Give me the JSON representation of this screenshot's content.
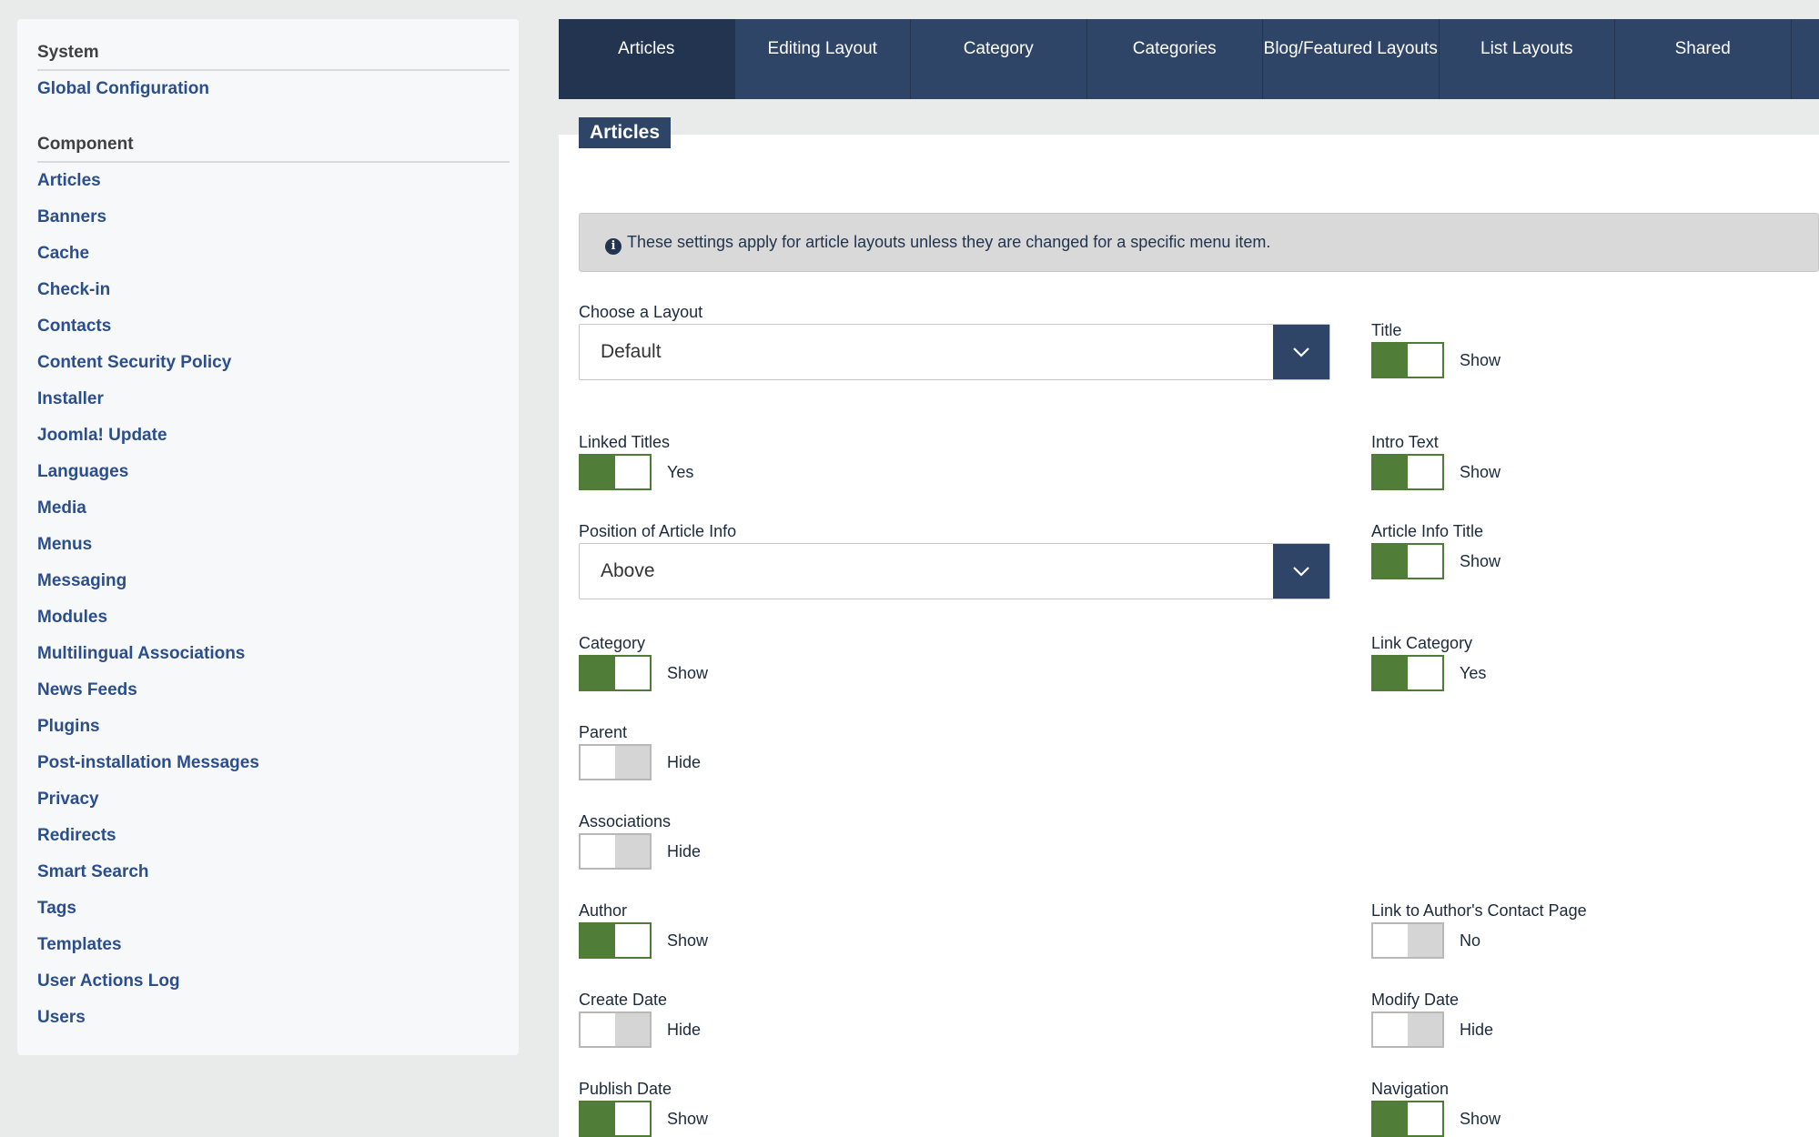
{
  "sidebar": {
    "system_heading": "System",
    "system_items": [
      {
        "label": "Global Configuration"
      }
    ],
    "component_heading": "Component",
    "component_items": [
      {
        "label": "Articles"
      },
      {
        "label": "Banners"
      },
      {
        "label": "Cache"
      },
      {
        "label": "Check-in"
      },
      {
        "label": "Contacts"
      },
      {
        "label": "Content Security Policy"
      },
      {
        "label": "Installer"
      },
      {
        "label": "Joomla! Update"
      },
      {
        "label": "Languages"
      },
      {
        "label": "Media"
      },
      {
        "label": "Menus"
      },
      {
        "label": "Messaging"
      },
      {
        "label": "Modules"
      },
      {
        "label": "Multilingual Associations"
      },
      {
        "label": "News Feeds"
      },
      {
        "label": "Plugins"
      },
      {
        "label": "Post-installation Messages"
      },
      {
        "label": "Privacy"
      },
      {
        "label": "Redirects"
      },
      {
        "label": "Smart Search"
      },
      {
        "label": "Tags"
      },
      {
        "label": "Templates"
      },
      {
        "label": "User Actions Log"
      },
      {
        "label": "Users"
      }
    ]
  },
  "tabs": [
    {
      "label": "Articles",
      "active": true
    },
    {
      "label": "Editing Layout"
    },
    {
      "label": "Category"
    },
    {
      "label": "Categories"
    },
    {
      "label": "Blog/Featured Layouts"
    },
    {
      "label": "List Layouts"
    },
    {
      "label": "Shared"
    }
  ],
  "section_title": "Articles",
  "info_text": "These settings apply for article layouts unless they are changed for a specific menu item.",
  "fields": {
    "choose_layout": {
      "label": "Choose a Layout",
      "value": "Default"
    },
    "linked_titles": {
      "label": "Linked Titles",
      "state": "Yes",
      "on": true
    },
    "position_article_info": {
      "label": "Position of Article Info",
      "value": "Above"
    },
    "category": {
      "label": "Category",
      "state": "Show",
      "on": true
    },
    "parent": {
      "label": "Parent",
      "state": "Hide",
      "on": false
    },
    "associations": {
      "label": "Associations",
      "state": "Hide",
      "on": false
    },
    "author": {
      "label": "Author",
      "state": "Show",
      "on": true
    },
    "create_date": {
      "label": "Create Date",
      "state": "Hide",
      "on": false
    },
    "publish_date": {
      "label": "Publish Date",
      "state": "Show",
      "on": true
    },
    "title": {
      "label": "Title",
      "state": "Show",
      "on": true
    },
    "intro_text": {
      "label": "Intro Text",
      "state": "Show",
      "on": true
    },
    "article_info_title": {
      "label": "Article Info Title",
      "state": "Show",
      "on": true
    },
    "link_category": {
      "label": "Link Category",
      "state": "Yes",
      "on": true
    },
    "link_author_contact": {
      "label": "Link to Author's Contact Page",
      "state": "No",
      "on": false
    },
    "modify_date": {
      "label": "Modify Date",
      "state": "Hide",
      "on": false
    },
    "navigation": {
      "label": "Navigation",
      "state": "Show",
      "on": true
    }
  },
  "colors": {
    "nav_bg": "#2f4567",
    "toggle_on": "#507e38",
    "toggle_off": "#d5d5d5",
    "link": "#2b4e8c"
  }
}
